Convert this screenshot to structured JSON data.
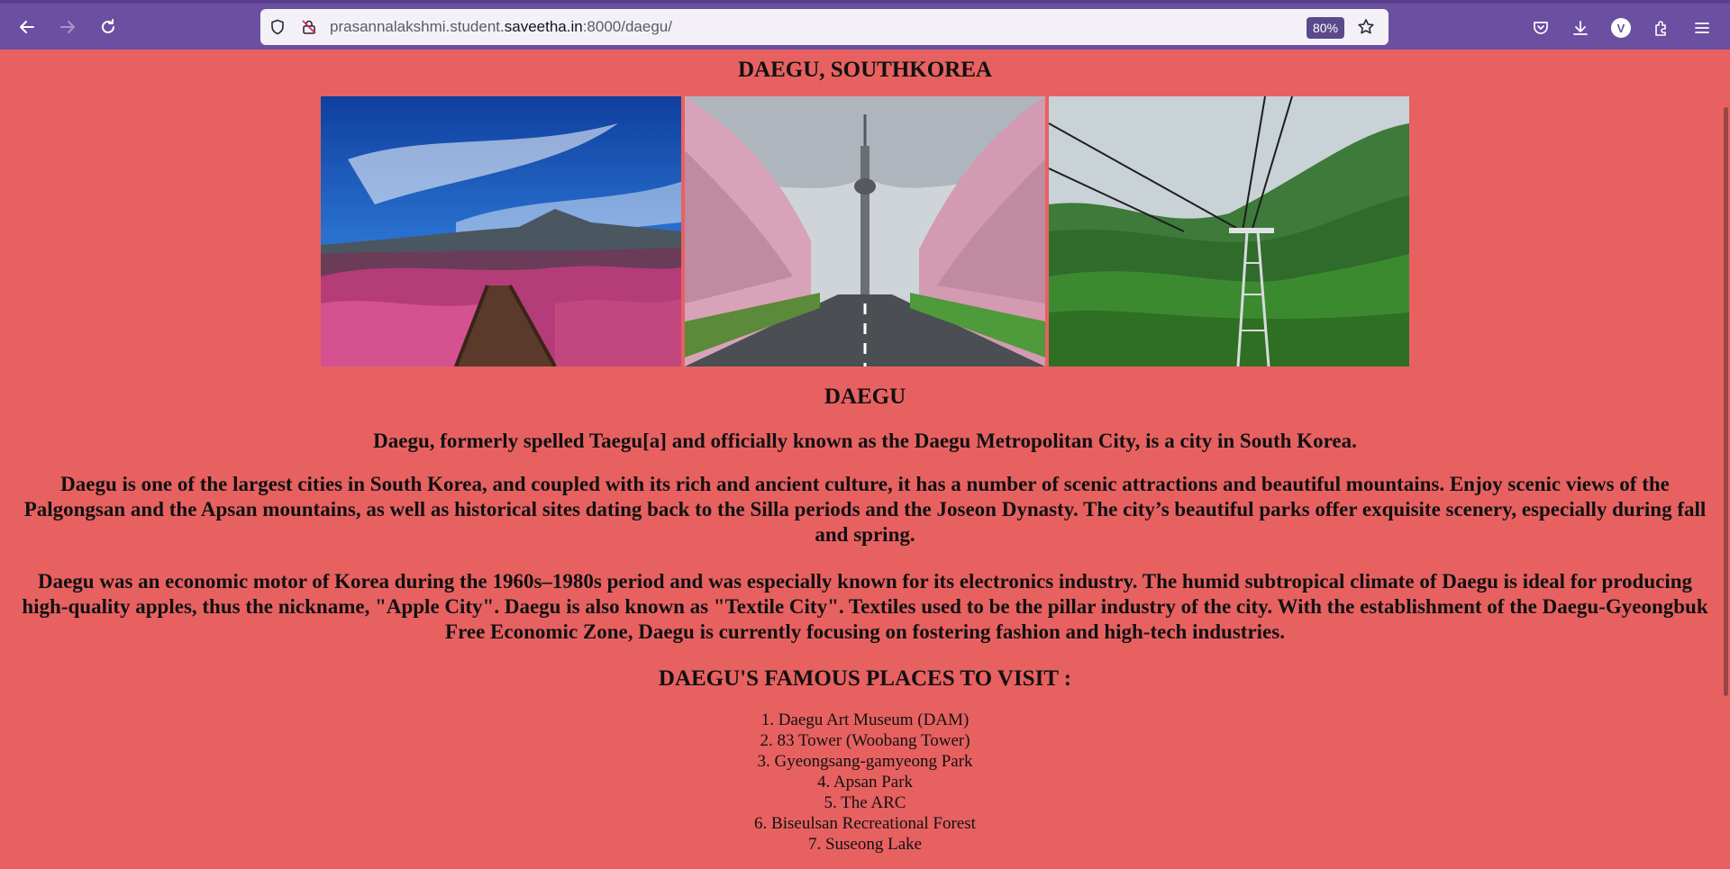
{
  "browser": {
    "url_prefix": "prasannalakshmi.student.",
    "url_domain": "saveetha.in",
    "url_suffix": ":8000/daegu/",
    "zoom": "80%",
    "profile_initial": "V"
  },
  "page": {
    "title": "DAEGU, SOUTHKOREA",
    "heading": "DAEGU",
    "intro": "Daegu, formerly spelled Taegu[a] and officially known as the Daegu Metropolitan City, is a city in South Korea.",
    "para1": "Daegu is one of the largest cities in South Korea, and coupled with its rich and ancient culture, it has a number of scenic attractions and beautiful mountains. Enjoy scenic views of the Palgongsan and the Apsan mountains, as well as historical sites dating back to the Silla periods and the Joseon Dynasty. The city’s beautiful parks offer exquisite scenery, especially during fall and spring.",
    "para2": "Daegu was an economic motor of Korea during the 1960s–1980s period and was especially known for its electronics industry. The humid subtropical climate of Daegu is ideal for producing high-quality apples, thus the nickname, \"Apple City\". Daegu is also known as \"Textile City\". Textiles used to be the pillar industry of the city. With the establishment of the Daegu-Gyeongbuk Free Economic Zone, Daegu is currently focusing on fostering fashion and high-tech industries.",
    "places_heading": "DAEGU'S FAMOUS PLACES TO VISIT :",
    "places": [
      "1. Daegu Art Museum (DAM)",
      "2. 83 Tower (Woobang Tower)",
      "3. Gyeongsang-gamyeong Park",
      "4. Apsan Park",
      "5. The ARC",
      "6. Biseulsan Recreational Forest",
      "7. Suseong Lake"
    ]
  },
  "colors": {
    "page_bg": "#e76161",
    "chrome_bg": "#6b4fa0"
  }
}
